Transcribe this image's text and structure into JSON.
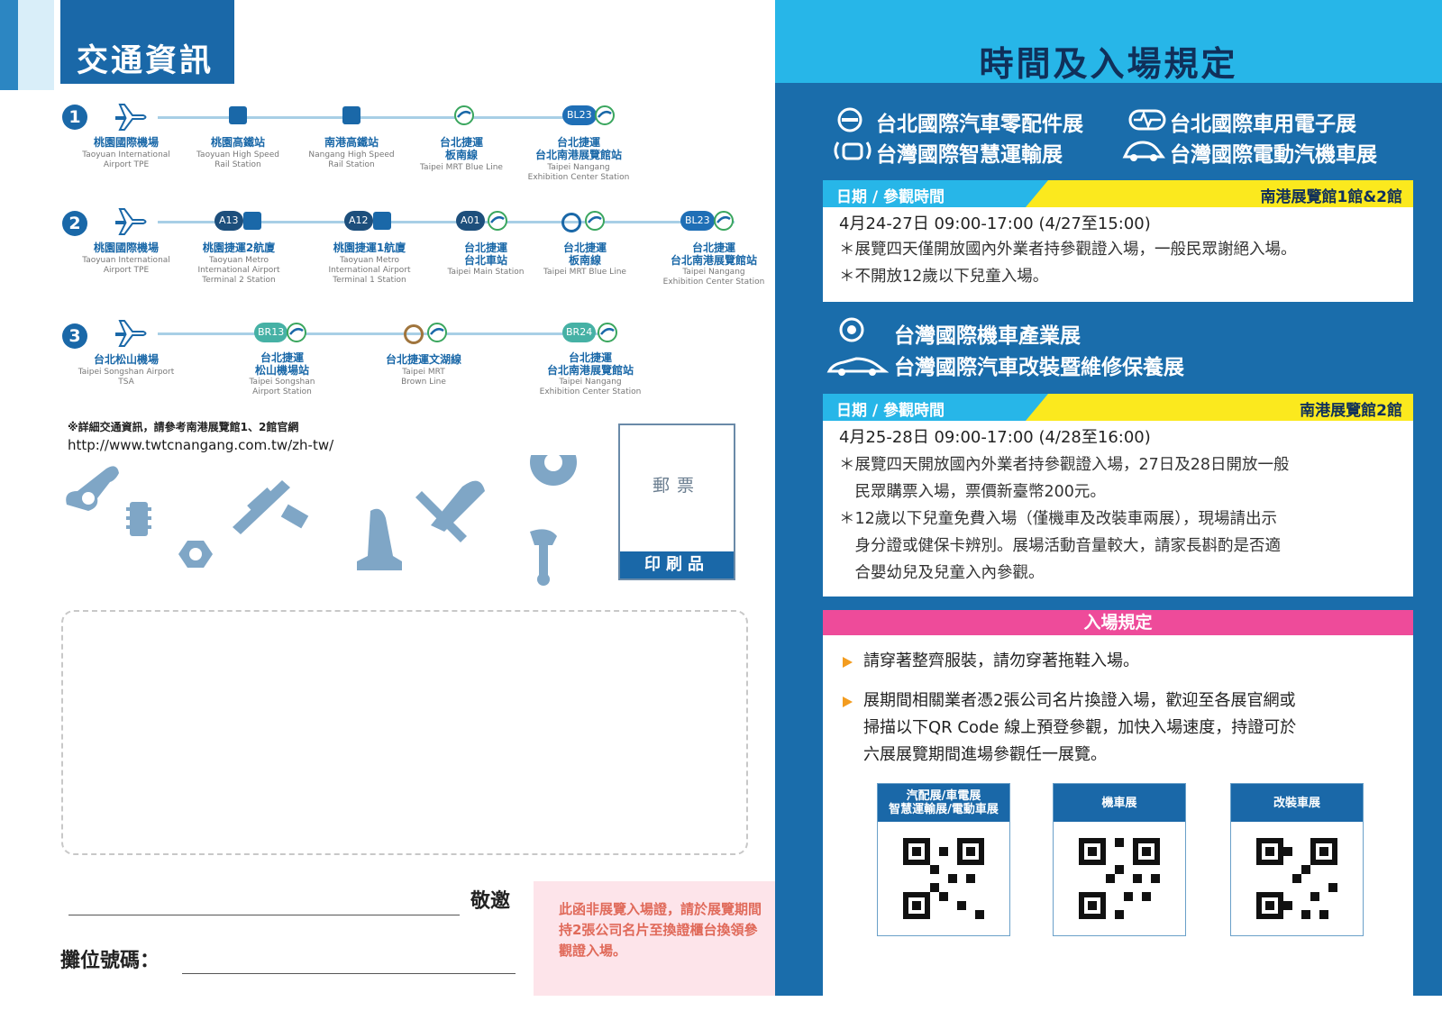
{
  "transport": {
    "title": "交通資訊",
    "routes": [
      {
        "number": "1",
        "stops": [
          {
            "cn": "桃園國際機場",
            "en": "Taoyuan International\nAirport TPE"
          },
          {
            "cn": "桃園高鐵站",
            "en": "Taoyuan High Speed\nRail Station"
          },
          {
            "cn": "南港高鐵站",
            "en": "Nangang High Speed\nRail Station"
          },
          {
            "cn": "台北捷運\n板南線",
            "en": "Taipei MRT Blue Line"
          },
          {
            "cn": "台北捷運\n台北南港展覽館站",
            "en": "Taipei Nangang\nExhibition Center Station",
            "badge": "BL23"
          }
        ]
      },
      {
        "number": "2",
        "stops": [
          {
            "cn": "桃園國際機場",
            "en": "Taoyuan International\nAirport TPE"
          },
          {
            "cn": "桃園捷運2航廈",
            "en": "Taoyuan Metro\nInternational Airport\nTerminal 2 Station",
            "badge": "A13"
          },
          {
            "cn": "桃園捷運1航廈",
            "en": "Taoyuan Metro\nInternational Airport\nTerminal 1 Station",
            "badge": "A12"
          },
          {
            "cn": "台北捷運\n台北車站",
            "en": "Taipei Main Station",
            "badge": "A01"
          },
          {
            "cn": "台北捷運\n板南線",
            "en": "Taipei MRT Blue Line"
          },
          {
            "cn": "台北捷運\n台北南港展覽館站",
            "en": "Taipei Nangang\nExhibition Center Station",
            "badge": "BL23"
          }
        ]
      },
      {
        "number": "3",
        "stops": [
          {
            "cn": "台北松山機場",
            "en": "Taipei Songshan Airport\nTSA"
          },
          {
            "cn": "台北捷運\n松山機場站",
            "en": "Taipei Songshan\nAirport Station",
            "badge": "BR13"
          },
          {
            "cn": "台北捷運文湖線",
            "en": "Taipei MRT\nBrown Line"
          },
          {
            "cn": "台北捷運\n台北南港展覽館站",
            "en": "Taipei Nangang\nExhibition Center Station",
            "badge": "BR24"
          }
        ]
      }
    ],
    "note": "※詳細交通資訊，請參考南港展覽館1、2館官網",
    "url": "http://www.twtcnangang.com.tw/zh-tw/"
  },
  "stamp": {
    "label": "郵票",
    "printed_matter": "印刷品"
  },
  "invite": {
    "respect": "敬邀",
    "booth_label": "攤位號碼：",
    "notice": "此函非展覽入場證，請於展覽期間持2張公司名片至換證櫃台換領參觀證入場。"
  },
  "rules_panel": {
    "title": "時間及入場規定",
    "group1": {
      "shows": [
        "台北國際汽車零配件展",
        "台北國際車用電子展",
        "台灣國際智慧運輸展",
        "台灣國際電動汽機車展"
      ],
      "header_label": "日期 / 參觀時間",
      "venue": "南港展覽館1館&2館",
      "time": "4月24-27日  09:00-17:00 (4/27至15:00)",
      "rules": [
        "＊展覽四天僅開放國內外業者持參觀證入場，一般民眾謝絕入場。",
        "＊不開放12歲以下兒童入場。"
      ]
    },
    "group2": {
      "shows": [
        "台灣國際機車產業展",
        "台灣國際汽車改裝暨維修保養展"
      ],
      "header_label": "日期 / 參觀時間",
      "venue": "南港展覽館2館",
      "time": "4月25-28日  09:00-17:00 (4/28至16:00)",
      "rules": [
        "＊展覽四天開放國內外業者持參觀證入場，27日及28日開放一般",
        "　民眾購票入場，票價新臺幣200元。",
        "＊12歲以下兒童免費入場（僅機車及改裝車兩展），現場請出示",
        "　身分證或健保卡辨別。展場活動音量較大，請家長斟酌是否適",
        "　合嬰幼兒及兒童入內參觀。"
      ]
    },
    "entry": {
      "header": "入場規定",
      "rules": [
        [
          "請穿著整齊服裝，請勿穿著拖鞋入場。"
        ],
        [
          "展期間相關業者憑2張公司名片換證入場，歡迎至各展官網或",
          "掃描以下QR Code 線上預登參觀，加快入場速度，持證可於",
          "六展展覽期間進場參觀任一展覽。"
        ]
      ],
      "qr_cards": [
        "汽配展/車電展\n智慧運輸展/電動車展",
        "機車展",
        "改裝車展"
      ]
    }
  },
  "colors": {
    "primary_blue": "#1a68a8",
    "sky_blue": "#27b6e8",
    "yellow": "#fbe91e",
    "pink": "#ee4b9a",
    "orange": "#f39c1f"
  }
}
